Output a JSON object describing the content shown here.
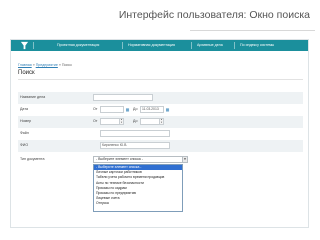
{
  "slide": {
    "title": "Интерфейс пользователя: Окно поиска"
  },
  "nav": {
    "tabs": [
      "Проектная документация",
      "Нормативная документация",
      "Архивные дела",
      "По индексу системы"
    ]
  },
  "breadcrumb": {
    "home": "Главная",
    "section": "Предприятие",
    "current": "Поиск",
    "separator": "»"
  },
  "page": {
    "title": "Поиск"
  },
  "form": {
    "name_label": "Название дела",
    "date_label": "Дата",
    "date_from_label": "От",
    "date_from_value": "",
    "date_to_label": "До",
    "date_to_value": "11.03.2013",
    "number_label": "Номер",
    "number_from_label": "От",
    "number_to_label": "До",
    "file_label": "Файл",
    "fio_label": "ФИО",
    "fio_value": "Кириленко Ю.В.",
    "doctype_label": "Тип документа",
    "doctype_value": "- Выберите элемент списка -"
  },
  "dropdown": {
    "options": [
      "- Выберите элемент списка -",
      "Личные карточки работников",
      "Табели учета рабочего времени продавцов",
      "Акты по технике безопасности",
      "Приказы по кадрам",
      "Приказы по предприятию",
      "Лицевые счета",
      "Отпуска"
    ],
    "selected_index": 0
  },
  "colors": {
    "topbar": "#1b8f9c",
    "link": "#2f7fb5",
    "selection": "#2f6fd1"
  },
  "icons": {
    "logo": "app-logo-icon",
    "calendar": "calendar-icon",
    "spinner": "spinner-arrows-icon",
    "dropdown_arrow": "chevron-down-icon"
  }
}
